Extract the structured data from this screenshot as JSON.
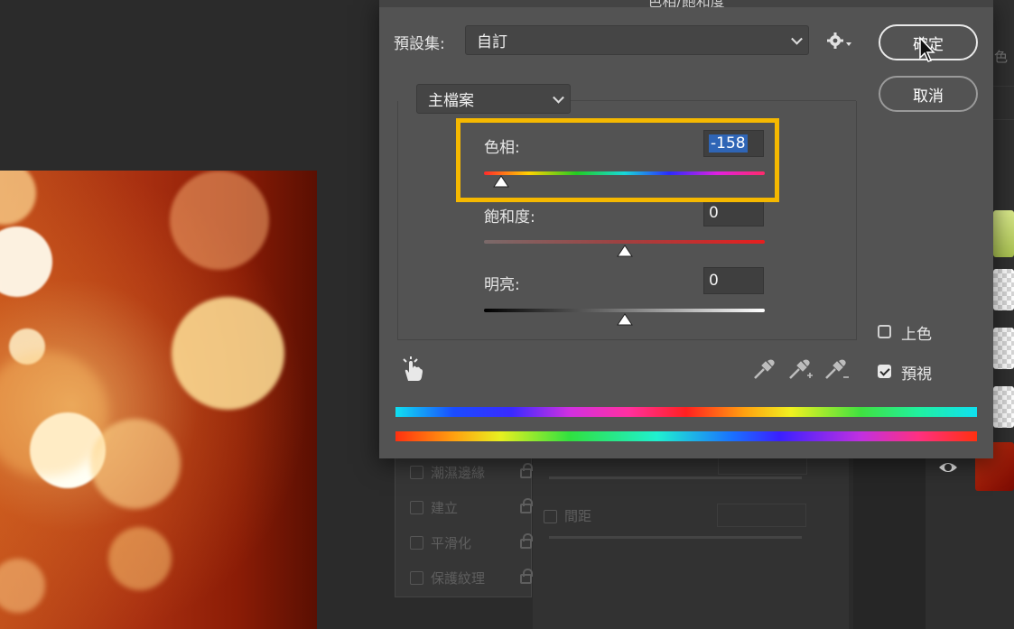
{
  "dialog": {
    "title": "色相/飽和度",
    "preset_label": "預設集:",
    "preset_value": "自訂",
    "ok_label": "確定",
    "cancel_label": "取消",
    "channel_value": "主檔案"
  },
  "sliders": {
    "hue": {
      "label": "色相:",
      "value": "-158",
      "level": -158
    },
    "saturation": {
      "label": "飽和度:",
      "value": "0",
      "level": 0
    },
    "lightness": {
      "label": "明亮:",
      "value": "0",
      "level": 0
    }
  },
  "options": {
    "colorize": {
      "label": "上色",
      "checked": false
    },
    "preview": {
      "label": "預視",
      "checked": true
    }
  },
  "background_panel": {
    "items": [
      "潮濕邊緣",
      "建立",
      "平滑化",
      "保護紋理"
    ],
    "spacing_label": "間距",
    "partial_label": "色"
  },
  "icons": {
    "settings": "gear-icon",
    "hand": "targeted-adjustment-hand-icon",
    "eyedroppers": [
      "eyedropper-icon",
      "eyedropper-add-icon",
      "eyedropper-subtract-icon"
    ],
    "visibility": "eye-icon"
  },
  "colors": {
    "highlight": "#f5b800",
    "selection": "#2f65b6"
  }
}
